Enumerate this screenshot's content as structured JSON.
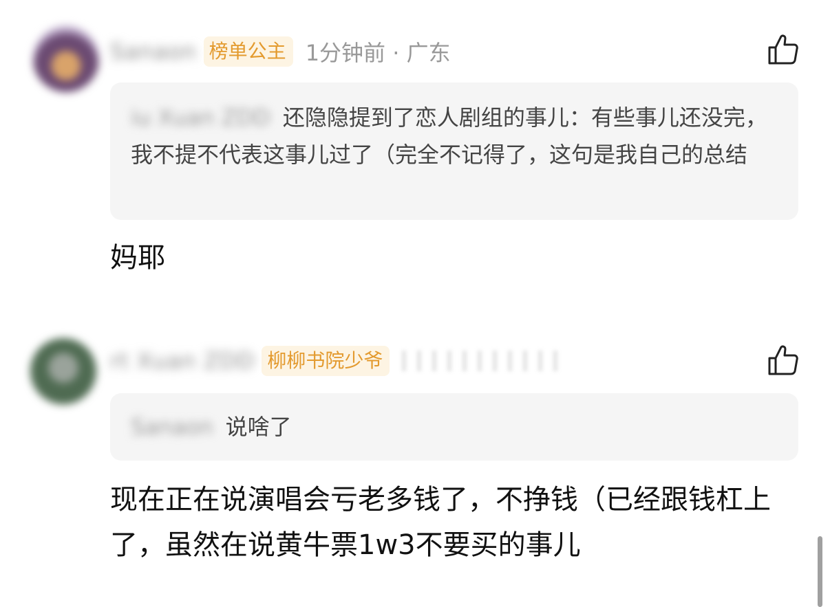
{
  "comments": [
    {
      "username": "Sanaon",
      "badge": "榜单公主",
      "time_location": "1分钟前 · 广东",
      "quote_user": "iu Xuan ZDD",
      "quote_text": "还隐隐提到了恋人剧组的事儿：有些事儿还没完，我不提不代表这事儿过了（完全不记得了，这句是我自己的总结",
      "text": "妈耶"
    },
    {
      "username": "rt Xuan ZDD",
      "badge": "柳柳书院少爷",
      "quote_user": "Sanaon",
      "quote_text": "说啥了",
      "text": "现在正在说演唱会亏老多钱了，不挣钱（已经跟钱杠上了，虽然在说黄牛票1w3不要买的事儿"
    }
  ],
  "colors": {
    "badge_text": "#e39a2e",
    "badge_bg": "#fdf4e3",
    "meta": "#999999",
    "quote_bg": "#f5f5f5"
  },
  "icons": [
    "like-icon"
  ]
}
